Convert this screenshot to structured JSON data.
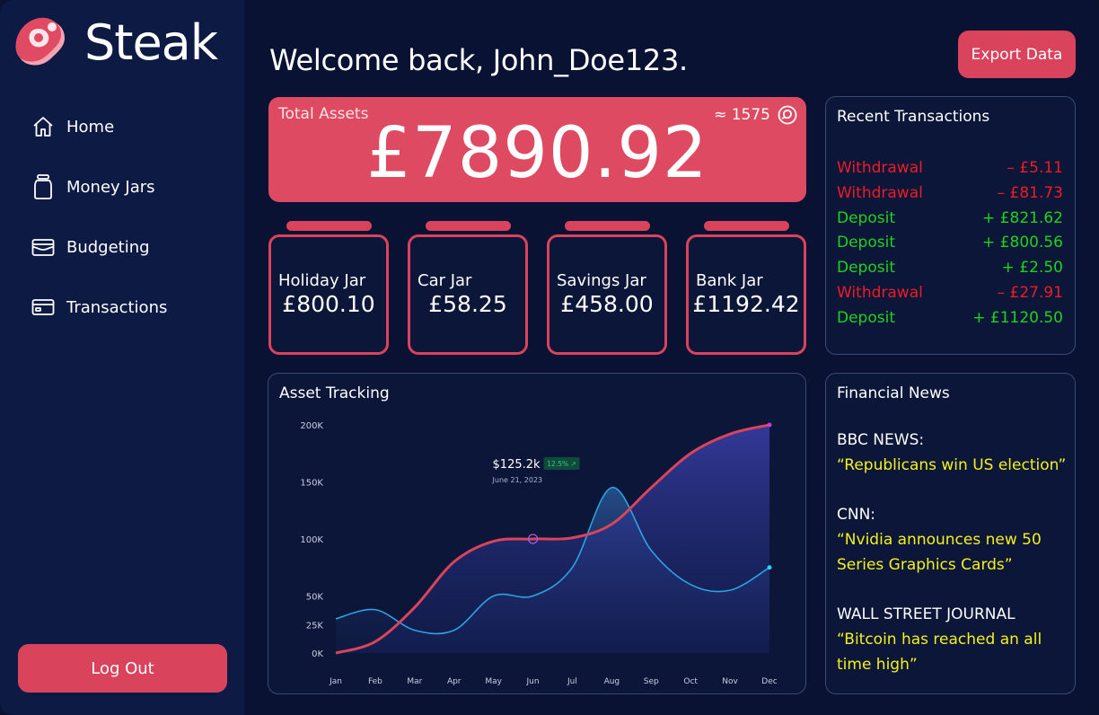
{
  "app": {
    "name": "Steak"
  },
  "nav": [
    {
      "label": "Home",
      "icon": "home-icon"
    },
    {
      "label": "Money Jars",
      "icon": "jar-icon"
    },
    {
      "label": "Budgeting",
      "icon": "wallet-icon"
    },
    {
      "label": "Transactions",
      "icon": "card-icon"
    }
  ],
  "logout_label": "Log Out",
  "welcome": "Welcome back, John_Doe123.",
  "export_label": "Export Data",
  "total": {
    "label": "Total Assets",
    "value": "£7890.92",
    "points": "≈ 1575"
  },
  "jars": [
    {
      "name": "Holiday Jar",
      "amount": "£800.10"
    },
    {
      "name": "Car Jar",
      "amount": "£58.25"
    },
    {
      "name": "Savings Jar",
      "amount": "£458.00"
    },
    {
      "name": "Bank Jar",
      "amount": "£1192.42"
    }
  ],
  "transactions": {
    "title": "Recent Transactions",
    "items": [
      {
        "type": "Withdrawal",
        "amount": "– £5.11",
        "kind": "withdraw"
      },
      {
        "type": "Withdrawal",
        "amount": "– £81.73",
        "kind": "withdraw"
      },
      {
        "type": "Deposit",
        "amount": "+ £821.62",
        "kind": "deposit"
      },
      {
        "type": "Deposit",
        "amount": "+ £800.56",
        "kind": "deposit"
      },
      {
        "type": "Deposit",
        "amount": "+ £2.50",
        "kind": "deposit"
      },
      {
        "type": "Withdrawal",
        "amount": "– £27.91",
        "kind": "withdraw"
      },
      {
        "type": "Deposit",
        "amount": "+ £1120.50",
        "kind": "deposit"
      }
    ]
  },
  "news": {
    "title": "Financial News",
    "items": [
      {
        "source": "BBC NEWS:",
        "headline": "“Republicans win US election”"
      },
      {
        "source": "CNN:",
        "headline": "“Nvidia announces new 50 Series Graphics Cards”"
      },
      {
        "source": "WALL STREET JOURNAL",
        "headline": "“Bitcoin has reached an all time high”"
      }
    ]
  },
  "colors": {
    "accent": "#de4a61",
    "bg": "#091232",
    "sidebar": "#0c1a44",
    "deposit": "#1fd31f",
    "withdraw": "#ee1c25",
    "headline": "#f4f11d"
  },
  "chart_data": {
    "type": "area",
    "title": "Asset Tracking",
    "categories": [
      "Jan",
      "Feb",
      "Mar",
      "Apr",
      "May",
      "Jun",
      "Jul",
      "Aug",
      "Sep",
      "Oct",
      "Nov",
      "Dec"
    ],
    "y_ticks": [
      "200K",
      "150K",
      "100K",
      "50K",
      "25K",
      "0K"
    ],
    "y_tick_values": [
      200,
      150,
      100,
      50,
      25,
      0
    ],
    "ylim": [
      0,
      200
    ],
    "series": [
      {
        "values": [
          0,
          10,
          40,
          80,
          98,
          100,
          101,
          113,
          145,
          175,
          192,
          200
        ],
        "color": "#d9435c"
      },
      {
        "values": [
          30,
          38,
          20,
          20,
          50,
          50,
          75,
          145,
          90,
          60,
          55,
          75
        ],
        "color": "#2aa3e0"
      }
    ],
    "tooltip": {
      "value": "$125.2k",
      "change": "12.5% ↗",
      "date": "June 21, 2023"
    }
  }
}
